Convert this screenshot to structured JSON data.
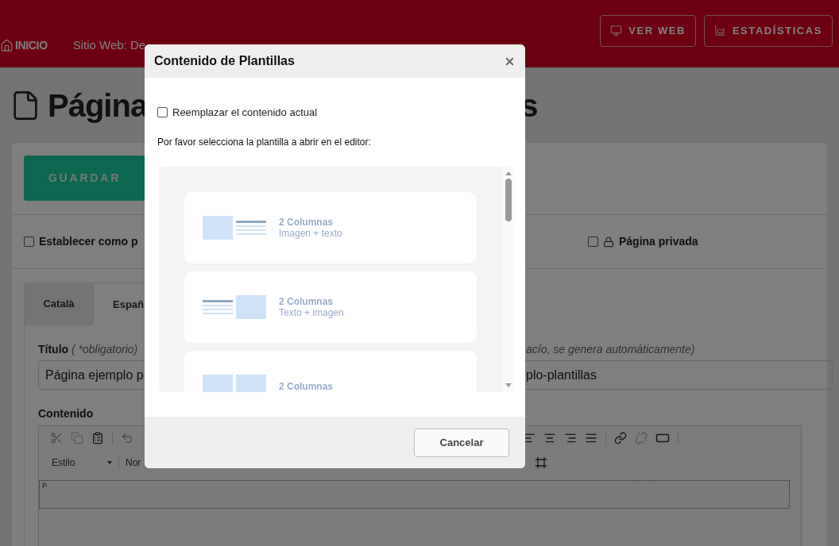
{
  "header": {
    "home": "INICIO",
    "site": "Sitio Web: De",
    "buttons": [
      {
        "label": "VER WEB",
        "kind": "monitor"
      },
      {
        "label": "ESTADÍSTICAS",
        "kind": "chart"
      }
    ]
  },
  "page": {
    "title_left": "Página",
    "title_right": "s",
    "save": "GUARDAR",
    "options": [
      {
        "label": "Establecer como p",
        "checked": false,
        "kind": "plain"
      },
      {
        "label": "Página privada",
        "checked": false,
        "kind": "lock"
      }
    ],
    "tabs": [
      {
        "label": "Català",
        "selected": false
      },
      {
        "label": "Españ",
        "selected": true
      }
    ],
    "title_label": "Título",
    "title_hint": "( *obligatorio)",
    "title_value": "Página ejemplo p",
    "url_hint": "acío, se genera automáticamente)",
    "url_value": "plo-plantillas",
    "content_label": "Contenido",
    "style_select": "Estilo",
    "format_select": "Nor",
    "path_tag": "P"
  },
  "dialog": {
    "title": "Contenido de Plantillas",
    "replace": {
      "label": "Reemplazar el contenido actual",
      "checked": false
    },
    "prompt": "Por favor selecciona la plantilla a abrir en el editor:",
    "templates": [
      {
        "title": "2 Columnas",
        "subtitle": "Imagen + texto",
        "kind": "image-text"
      },
      {
        "title": "2 Columnas",
        "subtitle": "Texto + imagen",
        "kind": "text-image"
      },
      {
        "title": "2 Columnas",
        "kind": "image-image"
      }
    ],
    "cancel": "Cancelar"
  }
}
